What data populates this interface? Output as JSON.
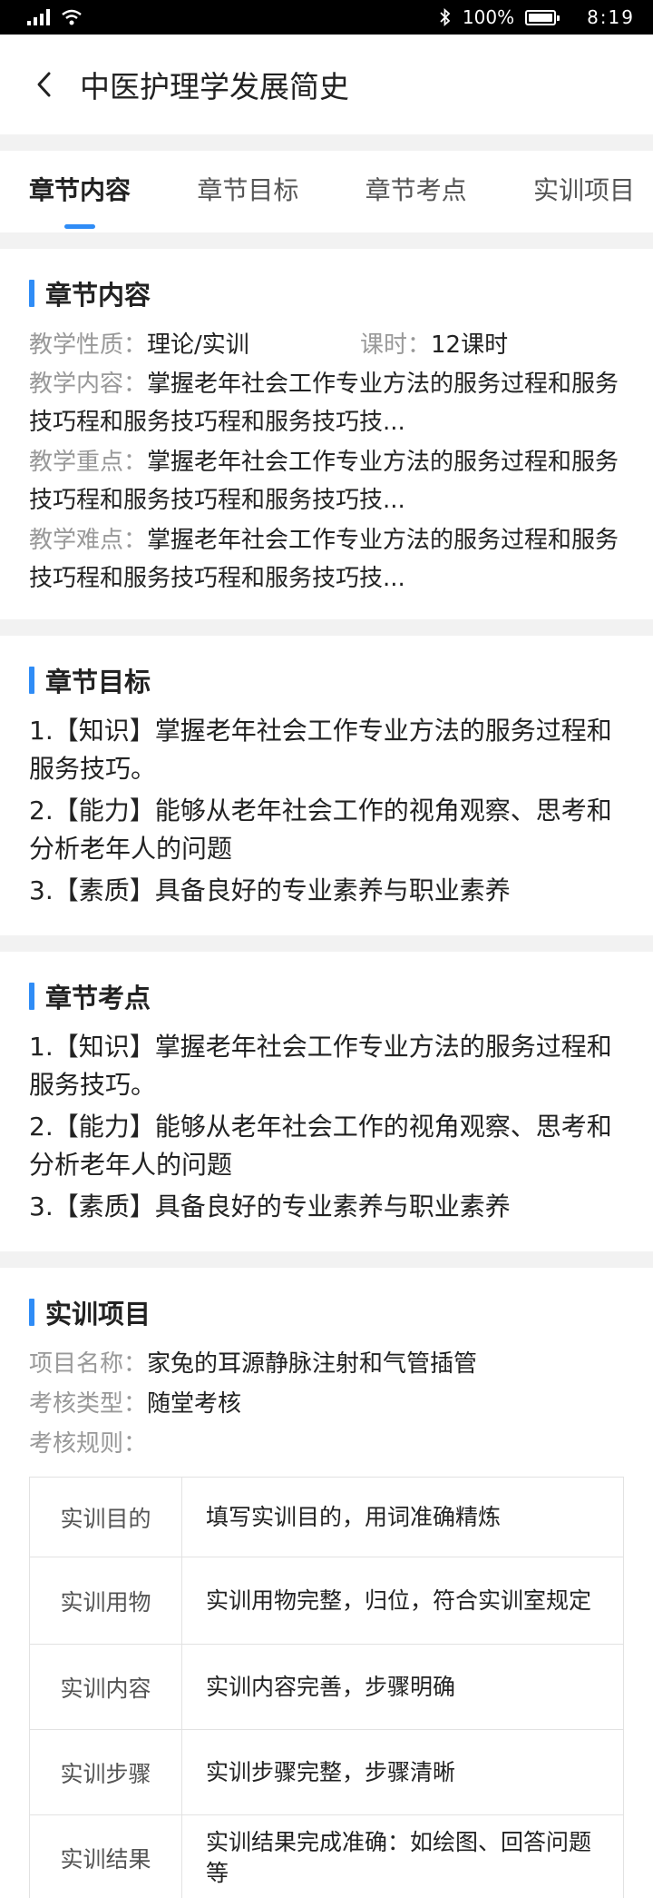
{
  "status": {
    "battery": "100%",
    "time": "8:19"
  },
  "header": {
    "title": "中医护理学发展简史"
  },
  "tabs": [
    {
      "label": "章节内容"
    },
    {
      "label": "章节目标"
    },
    {
      "label": "章节考点"
    },
    {
      "label": "实训项目"
    }
  ],
  "content": {
    "title": "章节内容",
    "nature_label": "教学性质：",
    "nature_value": "理论/实训",
    "hours_label": "课时：",
    "hours_value": "12课时",
    "teaching_content_label": "教学内容：",
    "teaching_content_value": "掌握老年社会工作专业方法的服务过程和服务技巧程和服务技巧程和服务技巧技...",
    "key_points_label": "教学重点：",
    "key_points_value": "掌握老年社会工作专业方法的服务过程和服务技巧程和服务技巧程和服务技巧技...",
    "difficulties_label": "教学难点：",
    "difficulties_value": "掌握老年社会工作专业方法的服务过程和服务技巧程和服务技巧程和服务技巧技..."
  },
  "goals": {
    "title": "章节目标",
    "items": [
      "1.【知识】掌握老年社会工作专业方法的服务过程和服务技巧。",
      "2.【能力】能够从老年社会工作的视角观察、思考和分析老年人的问题",
      "3.【素质】具备良好的专业素养与职业素养"
    ]
  },
  "exam_points": {
    "title": "章节考点",
    "items": [
      "1.【知识】掌握老年社会工作专业方法的服务过程和服务技巧。",
      "2.【能力】能够从老年社会工作的视角观察、思考和分析老年人的问题",
      "3.【素质】具备良好的专业素养与职业素养"
    ]
  },
  "training": {
    "title": "实训项目",
    "project_label": "项目名称：",
    "project_value": "家兔的耳源静脉注射和气管插管",
    "assessment_type_label": "考核类型：",
    "assessment_type_value": "随堂考核",
    "rules_label": "考核规则：",
    "rules": [
      {
        "name": "实训目的",
        "desc": "填写实训目的，用词准确精炼"
      },
      {
        "name": "实训用物",
        "desc": "实训用物完整，归位，符合实训室规定"
      },
      {
        "name": "实训内容",
        "desc": "实训内容完善，步骤明确"
      },
      {
        "name": "实训步骤",
        "desc": "实训步骤完整，步骤清晰"
      },
      {
        "name": "实训结果",
        "desc": "实训结果完成准确：如绘图、回答问题等"
      }
    ]
  }
}
